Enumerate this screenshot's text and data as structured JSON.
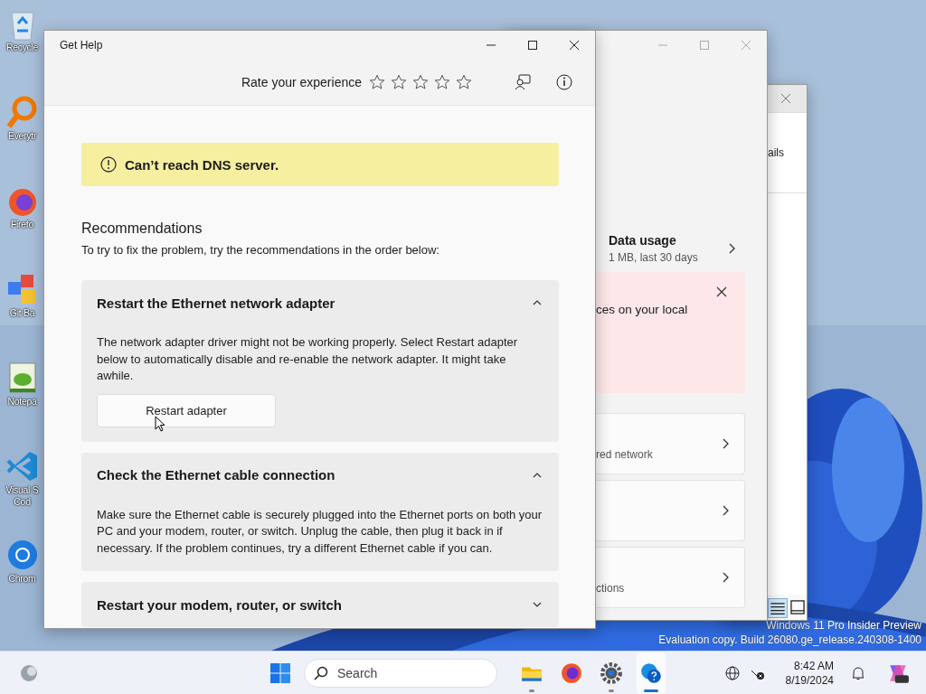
{
  "desktop": {
    "icons": [
      {
        "kind": "recycle",
        "label": "Recycle"
      },
      {
        "kind": "search",
        "label": "Everytr"
      },
      {
        "kind": "browser",
        "label": "Firefo"
      },
      {
        "kind": "git",
        "label": "Git Ba"
      },
      {
        "kind": "notepad",
        "label": "Notepa"
      },
      {
        "kind": "code",
        "label": "Visual S\nCod"
      },
      {
        "kind": "chrome",
        "label": "Chrom"
      }
    ],
    "watermark": [
      "Windows 11 Pro Insider Preview",
      "Evaluation copy. Build 26080.ge_release.240308-1400"
    ]
  },
  "back_window": {
    "tab_label": "ails"
  },
  "settings_window": {
    "items": [
      {
        "kind": "usage",
        "title": "Data usage",
        "subtitle": "1 MB, last 30 days"
      },
      {
        "kind": "alert",
        "text": "ces on your local"
      },
      {
        "kind": "link",
        "subtitle": "red network"
      },
      {
        "kind": "link"
      },
      {
        "kind": "link",
        "subtitle": "ctions"
      }
    ]
  },
  "help_window": {
    "title": "Get Help",
    "rating": {
      "label": "Rate your experience",
      "stars": 0
    },
    "banner": "Can’t reach DNS server.",
    "heading": "Recommendations",
    "intro": "To try to fix the problem, try the recommendations in the order below:",
    "steps": [
      {
        "title": "Restart the Ethernet network adapter",
        "expanded": true,
        "body": "The network adapter driver might not be working properly. Select Restart adapter below to automatically disable and re-enable the network adapter. It might take awhile.",
        "button": "Restart adapter"
      },
      {
        "title": "Check the Ethernet cable connection",
        "expanded": true,
        "body": "Make sure the Ethernet cable is securely plugged into the Ethernet ports on both your PC and your modem, router, or switch. Unplug the cable, then plug it back in if necessary. If the problem continues, try a different Ethernet cable if you can."
      },
      {
        "title": "Restart your modem, router, or switch",
        "expanded": false
      }
    ]
  },
  "taskbar": {
    "search_placeholder": "Search",
    "apps": [
      {
        "kind": "folder",
        "running": true,
        "selected": false
      },
      {
        "kind": "browser",
        "running": false,
        "selected": false
      },
      {
        "kind": "gear",
        "running": true,
        "selected": false
      },
      {
        "kind": "help",
        "running": true,
        "selected": true
      }
    ],
    "time": "8:42 AM",
    "date": "8/19/2024"
  }
}
